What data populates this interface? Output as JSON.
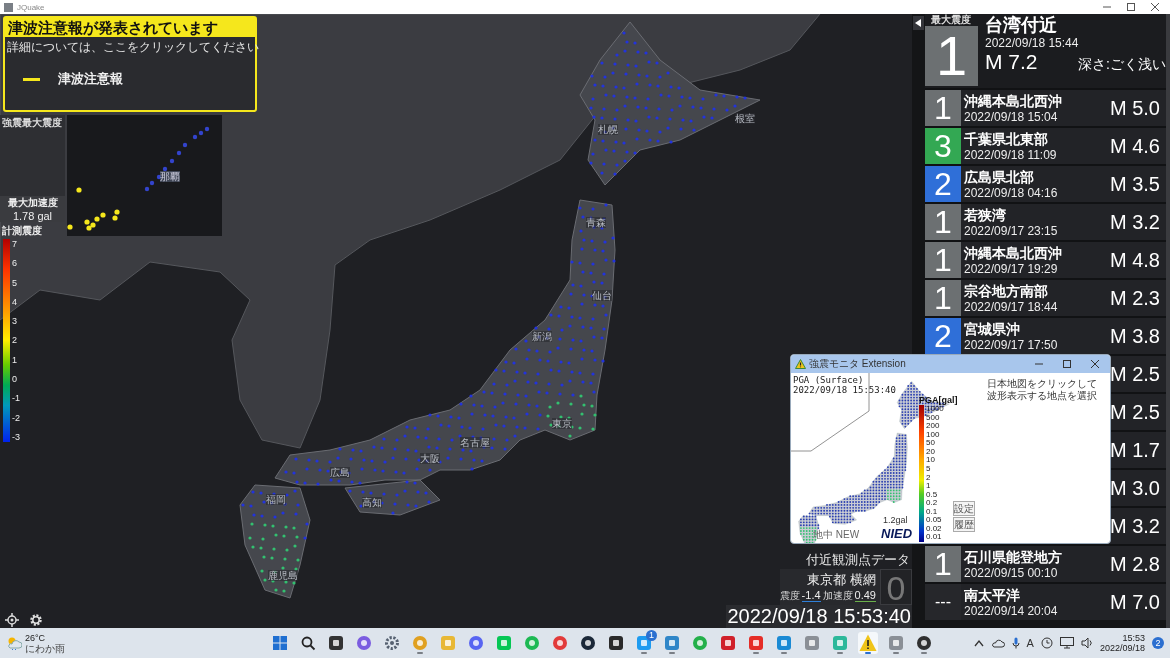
{
  "window": {
    "title": "JQuake"
  },
  "tsunami_alert": {
    "title": "津波注意報が発表されています",
    "message": "詳細については、ここをクリックしてください",
    "legend": [
      {
        "label": "津波注意報",
        "color": "#f5e71c"
      }
    ]
  },
  "max_intensity_panel": {
    "title": "強震最大震度",
    "acceleration_label": "最大加速度",
    "acceleration": "1.78 gal"
  },
  "inset_map": {
    "labels": [
      "那覇"
    ]
  },
  "intensity_scale": {
    "title": "計測震度",
    "ticks": [
      "7",
      "6",
      "5",
      "4",
      "3",
      "2",
      "1",
      "0",
      "-1",
      "-2",
      "-3"
    ]
  },
  "map": {
    "labels": [
      "札幌",
      "根室",
      "青森",
      "仙台",
      "新潟",
      "東京",
      "名古屋",
      "大阪",
      "広島",
      "高知",
      "福岡",
      "鹿児島"
    ]
  },
  "nearby_station": {
    "title": "付近観測点データ",
    "station": "東京都 横網",
    "intensity_label": "震度",
    "intensity": "-1.4",
    "acceleration_label": "加速度",
    "acceleration": "0.49",
    "shindo": "0",
    "timestamp": "2022/09/18 15:53:40"
  },
  "latest_quake": {
    "header": "最大震度",
    "shindo": "1",
    "color": "#6c7072",
    "region": "台湾付近",
    "time": "2022/09/18 15:44",
    "magnitude": "M 7.2",
    "depth": "深さ:ごく浅い"
  },
  "quake_list": [
    {
      "shindo": "1",
      "color": "#6c7072",
      "region": "沖縄本島北西沖",
      "time": "2022/09/18 15:04",
      "magnitude": "M 5.0"
    },
    {
      "shindo": "3",
      "color": "#33a853",
      "region": "千葉県北東部",
      "time": "2022/09/18 11:09",
      "magnitude": "M 4.6"
    },
    {
      "shindo": "2",
      "color": "#2f6fd8",
      "region": "広島県北部",
      "time": "2022/09/18 04:16",
      "magnitude": "M 3.5"
    },
    {
      "shindo": "1",
      "color": "#6c7072",
      "region": "若狭湾",
      "time": "2022/09/17 23:15",
      "magnitude": "M 3.2"
    },
    {
      "shindo": "1",
      "color": "#6c7072",
      "region": "沖縄本島北西沖",
      "time": "2022/09/17 19:29",
      "magnitude": "M 4.8"
    },
    {
      "shindo": "1",
      "color": "#6c7072",
      "region": "宗谷地方南部",
      "time": "2022/09/17 18:44",
      "magnitude": "M 2.3"
    },
    {
      "shindo": "2",
      "color": "#2f6fd8",
      "region": "宮城県沖",
      "time": "2022/09/17 17:50",
      "magnitude": "M 3.8"
    },
    {
      "magnitude": "M 2.5"
    },
    {
      "magnitude": "M 2.5"
    },
    {
      "magnitude": "M 1.7"
    },
    {
      "magnitude": "M 3.0"
    },
    {
      "magnitude": "M 3.2"
    },
    {
      "shindo": "1",
      "color": "#6c7072",
      "region": "石川県能登地方",
      "time": "2022/09/15 00:10",
      "magnitude": "M 2.8"
    },
    {
      "shindo": "---",
      "color": "#26272b",
      "region": "南太平洋",
      "time": "2022/09/14 20:04",
      "magnitude": "M 7.0"
    }
  ],
  "popup": {
    "title": "強震モニタ Extension",
    "graph_title": "PGA (Surface)",
    "graph_time": "2022/09/18 15:53:40",
    "scale_title": "PGA[gal]",
    "scale_ticks": [
      "1000",
      "500",
      "200",
      "100",
      "50",
      "20",
      "10",
      "5",
      "2",
      "1",
      "0.5",
      "0.2",
      "0.1",
      "0.05",
      "0.02",
      "0.01"
    ],
    "max_value": "1.2gal",
    "logo": "NIED",
    "layer": "地中 NEW",
    "hint": "日本地図をクリックして波形表示する地点を選択",
    "buttons": [
      "設定",
      "履歴"
    ]
  },
  "taskbar": {
    "temperature": "26°C",
    "condition": "にわか雨",
    "apps": [
      {
        "kind": "start",
        "color": "#1f6fd1",
        "running": false,
        "selected": false
      },
      {
        "kind": "search",
        "color": "#222222",
        "running": false,
        "selected": false
      },
      {
        "kind": "square",
        "color": "#333333",
        "running": false,
        "selected": false
      },
      {
        "kind": "circle",
        "color": "#7b5ce0",
        "running": false,
        "selected": false
      },
      {
        "kind": "gear",
        "color": "#556070",
        "running": false,
        "selected": false
      },
      {
        "kind": "circle",
        "color": "#e0a020",
        "running": true,
        "selected": false
      },
      {
        "kind": "square",
        "color": "#e8b835",
        "running": false,
        "selected": false
      },
      {
        "kind": "circle",
        "color": "#5865f2",
        "running": false,
        "selected": false
      },
      {
        "kind": "square",
        "color": "#06c755",
        "running": false,
        "selected": false
      },
      {
        "kind": "circle",
        "color": "#1db954",
        "running": false,
        "selected": false
      },
      {
        "kind": "circle",
        "color": "#e23a3a",
        "running": false,
        "selected": false
      },
      {
        "kind": "circle",
        "color": "#1b2838",
        "running": false,
        "selected": false
      },
      {
        "kind": "square",
        "color": "#2a2a2a",
        "running": false,
        "selected": false
      },
      {
        "kind": "square",
        "color": "#1d9bf0",
        "running": true,
        "selected": false,
        "badge": "1"
      },
      {
        "kind": "square",
        "color": "#2f86c8",
        "running": true,
        "selected": false
      },
      {
        "kind": "circle",
        "color": "#23b04a",
        "running": false,
        "selected": false
      },
      {
        "kind": "square",
        "color": "#d0202a",
        "running": false,
        "selected": false
      },
      {
        "kind": "square",
        "color": "#e52d27",
        "running": true,
        "selected": false
      },
      {
        "kind": "square",
        "color": "#1a8ad4",
        "running": true,
        "selected": false
      },
      {
        "kind": "square",
        "color": "#8a8f96",
        "running": false,
        "selected": false
      },
      {
        "kind": "square",
        "color": "#2cb89a",
        "running": true,
        "selected": false
      },
      {
        "kind": "warning",
        "color": "#f0c419",
        "running": true,
        "selected": true
      },
      {
        "kind": "square",
        "color": "#8a8f96",
        "running": true,
        "selected": false
      },
      {
        "kind": "circle",
        "color": "#303030",
        "running": true,
        "selected": false
      }
    ],
    "ime": "A",
    "time": "15:53",
    "date": "2022/09/18",
    "notifications": "2"
  }
}
